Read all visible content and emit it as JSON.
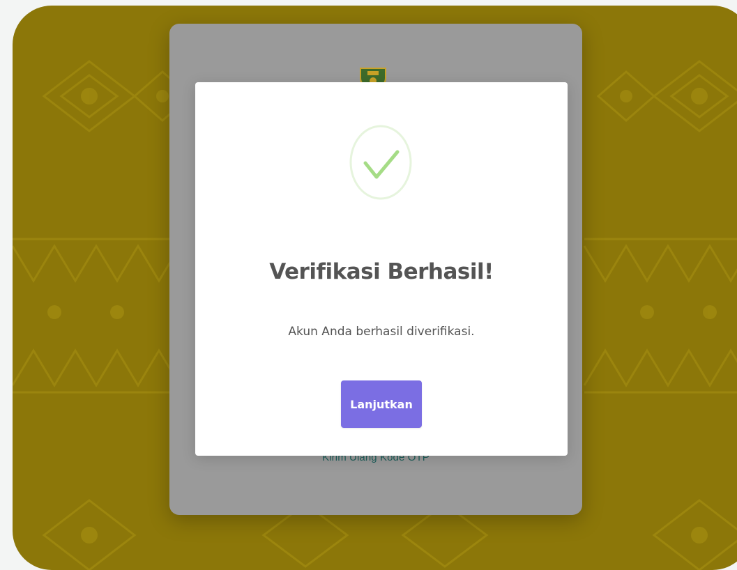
{
  "colors": {
    "background": "#8c7709",
    "card": "#9a9a9a",
    "modal": "#ffffff",
    "success_green": "#a5dc86",
    "button": "#7b6ee3",
    "link": "#1f5f5b",
    "text": "#545454"
  },
  "login_card": {
    "logo_icon": "regional-crest-icon",
    "resend_link": "Kirim Ulang Kode OTP"
  },
  "modal": {
    "icon": "success-check-icon",
    "title": "Verifikasi Berhasil!",
    "message": "Akun Anda berhasil diverifikasi.",
    "confirm_button": "Lanjutkan"
  }
}
